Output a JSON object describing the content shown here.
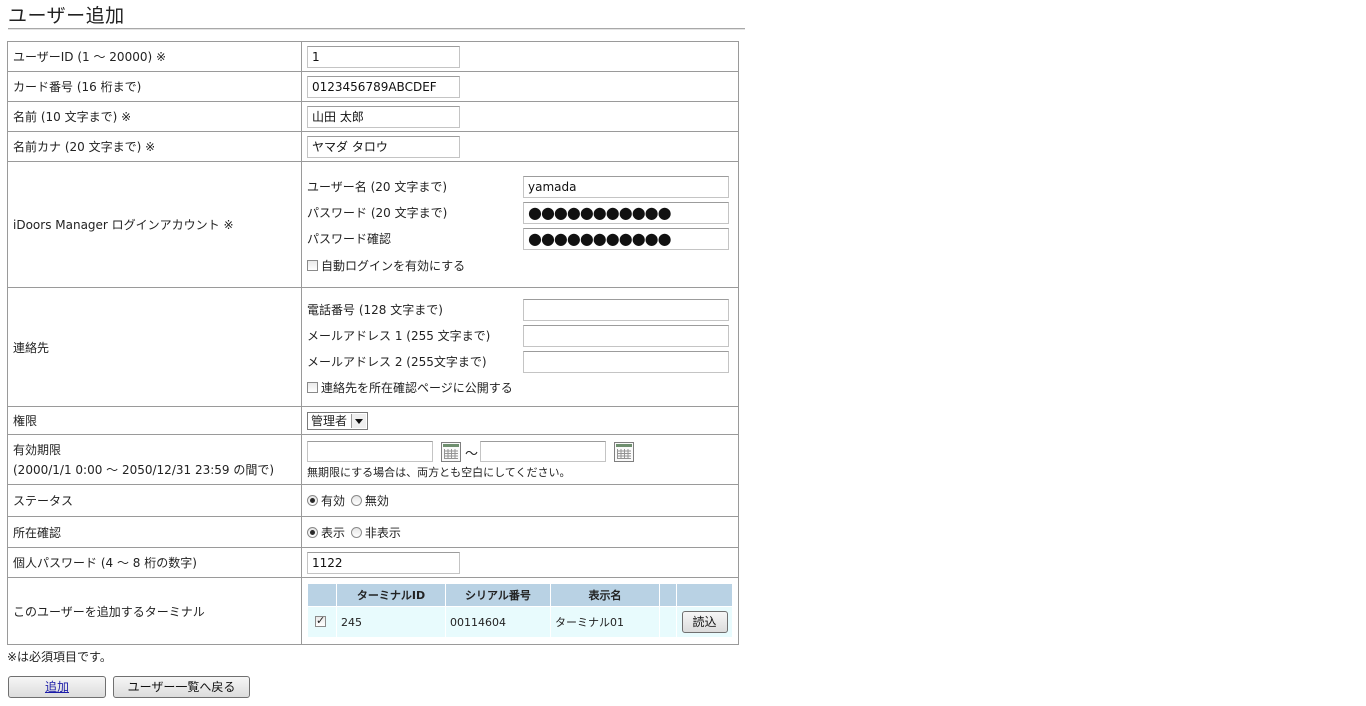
{
  "page": {
    "title": "ユーザー追加"
  },
  "fields": {
    "user_id": {
      "label": "ユーザーID (1 ～ 20000) ※",
      "value": "1"
    },
    "card_number": {
      "label": "カード番号 (16 桁まで)",
      "value": "0123456789ABCDEF"
    },
    "name": {
      "label": "名前 (10 文字まで) ※",
      "value": "山田 太郎"
    },
    "name_kana": {
      "label": "名前カナ (20 文字まで) ※",
      "value": "ヤマダ タロウ"
    }
  },
  "login_account": {
    "label": "iDoors Manager ログインアカウント ※",
    "username_label": "ユーザー名 (20 文字まで)",
    "username_value": "yamada",
    "password_label": "パスワード (20 文字まで)",
    "password_value": "●●●●●●●●●●●",
    "password_confirm_label": "パスワード確認",
    "password_confirm_value": "●●●●●●●●●●●",
    "auto_login_label": "自動ログインを有効にする",
    "auto_login_checked": false
  },
  "contact": {
    "label": "連絡先",
    "phone_label": "電話番号 (128 文字まで)",
    "phone_value": "",
    "email1_label": "メールアドレス 1 (255 文字まで)",
    "email1_value": "",
    "email2_label": "メールアドレス 2 (255文字まで)",
    "email2_value": "",
    "publish_label": "連絡先を所在確認ページに公開する",
    "publish_checked": false
  },
  "permission": {
    "label": "権限",
    "selected": "管理者"
  },
  "validity": {
    "label_line1": "有効期限",
    "label_line2": "(2000/1/1 0:00 ～ 2050/12/31 23:59 の間で)",
    "start_value": "",
    "tilde": "～",
    "end_value": "",
    "note": "無期限にする場合は、両方とも空白にしてください。"
  },
  "status": {
    "label": "ステータス",
    "options": [
      "有効",
      "無効"
    ],
    "selected": "有効"
  },
  "presence": {
    "label": "所在確認",
    "options": [
      "表示",
      "非表示"
    ],
    "selected": "表示"
  },
  "personal_password": {
    "label": "個人パスワード (4 ～ 8 桁の数字)",
    "value": "1122"
  },
  "terminals": {
    "label": "このユーザーを追加するターミナル",
    "columns": [
      "",
      "ターミナルID",
      "シリアル番号",
      "表示名",
      "",
      ""
    ],
    "rows": [
      {
        "checked": true,
        "terminal_id": "245",
        "serial": "00114604",
        "display_name": "ターミナル01",
        "action": "読込"
      }
    ]
  },
  "footer": {
    "required_note": "※は必須項目です。",
    "add_button": "追加",
    "back_button": "ユーザー一覧へ戻る"
  },
  "colors": {
    "table_header": "#b9d2e4",
    "table_row": "#e8fbfd",
    "link_blue": "#1b1ba8"
  }
}
